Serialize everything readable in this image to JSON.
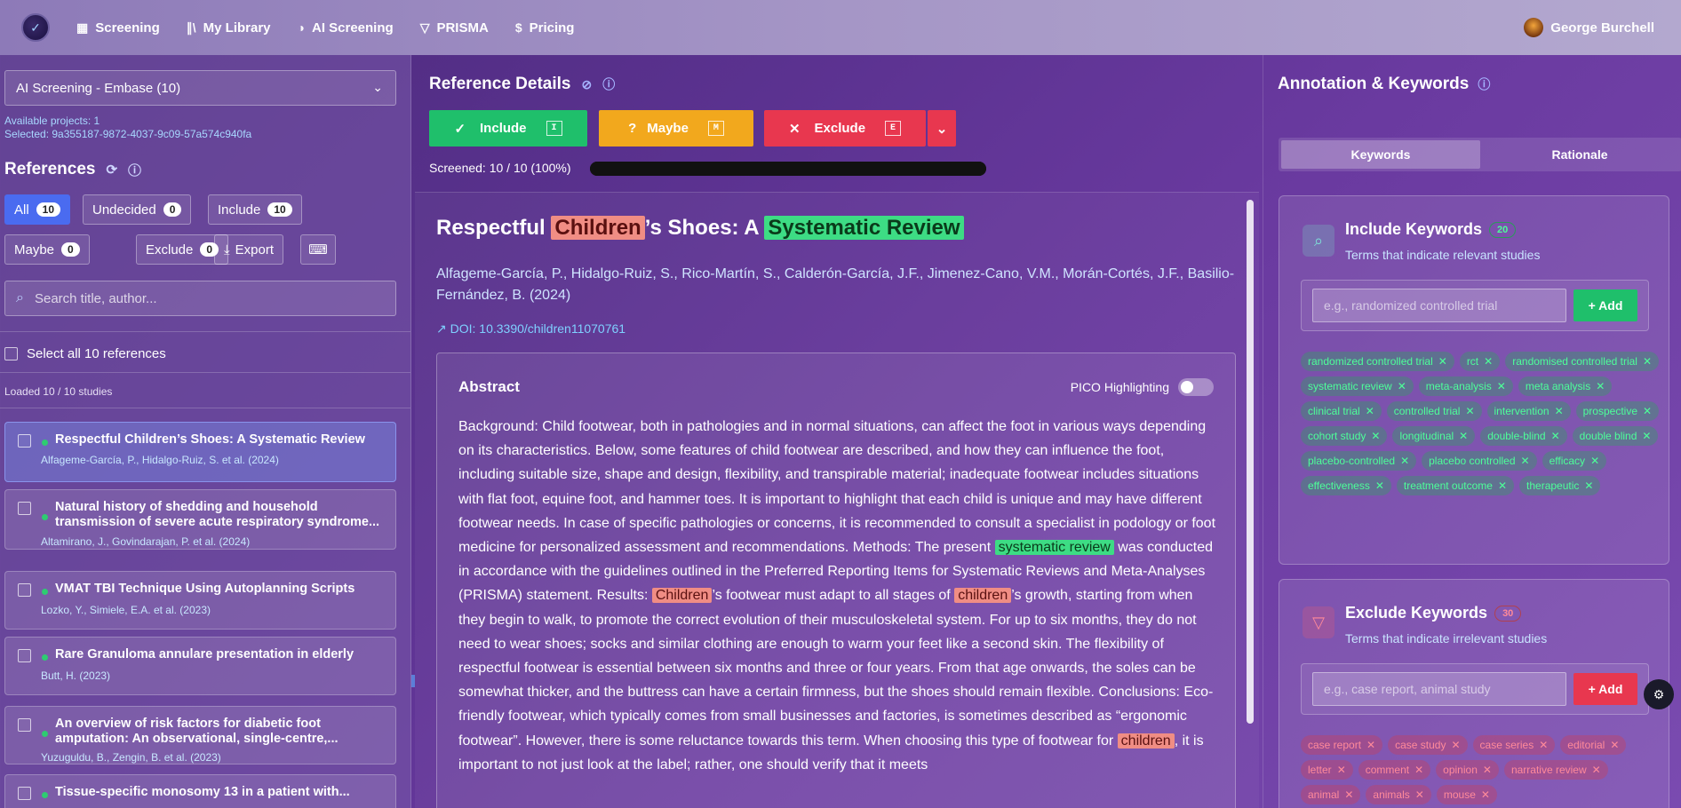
{
  "nav": {
    "items": [
      {
        "icon": "grid-icon",
        "label": "Screening"
      },
      {
        "icon": "library-icon",
        "label": "My Library"
      },
      {
        "icon": "ai-icon",
        "label": "AI Screening"
      },
      {
        "icon": "filter-icon",
        "label": "PRISMA"
      },
      {
        "icon": "dollar-icon",
        "label": "Pricing"
      }
    ],
    "user": "George Burchell"
  },
  "left": {
    "project_select": "AI Screening - Embase (10)",
    "available": "Available projects: 1",
    "selected": "Selected: 9a355187-9872-4037-9c09-57a574c940fa",
    "title": "References",
    "filters": [
      {
        "label": "All",
        "count": "10"
      },
      {
        "label": "Undecided",
        "count": "0"
      },
      {
        "label": "Include",
        "count": "10"
      },
      {
        "label": "Maybe",
        "count": "0"
      },
      {
        "label": "Exclude",
        "count": "0"
      }
    ],
    "export_label": "Export",
    "search_placeholder": "Search title, author...",
    "select_all": "Select all 10 references",
    "loaded": "Loaded 10 / 10 studies",
    "refs": [
      {
        "title": "Respectful Children’s Shoes: A Systematic Review",
        "authors": "Alfageme-García, P., Hidalgo-Ruiz, S. et al. (2024)"
      },
      {
        "title": "Natural history of shedding and household transmission of severe acute respiratory syndrome...",
        "authors": "Altamirano, J., Govindarajan, P. et al. (2024)"
      },
      {
        "title": "VMAT TBI Technique Using Autoplanning Scripts",
        "authors": "Lozko, Y., Simiele, E.A. et al. (2023)"
      },
      {
        "title": "Rare Granuloma annulare presentation in elderly",
        "authors": "Butt, H. (2023)"
      },
      {
        "title": "An overview of risk factors for diabetic foot amputation: An observational, single-centre,...",
        "authors": "Yuzuguldu, B., Zengin, B. et al. (2023)"
      },
      {
        "title": "Tissue-specific monosomy 13 in a patient with...",
        "authors": ""
      }
    ]
  },
  "mid": {
    "title": "Reference Details",
    "decisions": [
      {
        "label": "Include",
        "key": "I"
      },
      {
        "label": "Maybe",
        "key": "M"
      },
      {
        "label": "Exclude",
        "key": "E"
      }
    ],
    "screened": "Screened: 10 / 10 (100%)",
    "progress": 1.0,
    "article": {
      "title_pre": "Respectful ",
      "title_hl1": "Children",
      "title_mid": "’s Shoes: A ",
      "title_hl2": "Systematic Review",
      "authors": "Alfageme-García, P., Hidalgo-Ruiz, S., Rico-Martín, S., Calderón-García, J.F., Jimenez-Cano, V.M., Morán-Cortés, J.F., Basilio-Fernández, B. (2024)",
      "doi": "DOI: 10.3390/children11070761"
    },
    "abstract": {
      "heading": "Abstract",
      "pico_label": "PICO Highlighting",
      "p1": "Background: Child footwear, both in pathologies and in normal situations, can affect the foot in various ways depending on its characteristics. Below, some features of child footwear are described, and how they can influence the foot, including suitable size, shape and design, flexibility, and transpirable material; inadequate footwear includes situations with flat foot, equine foot, and hammer toes. It is important to highlight that each child is unique and may have different footwear needs. In case of specific pathologies or concerns, it is recommended to consult a specialist in podology or foot medicine for personalized assessment and recommendations. Methods: The present ",
      "hl1": "systematic review",
      "p2": " was conducted in accordance with the guidelines outlined in the Preferred Reporting Items for Systematic Reviews and Meta-Analyses (PRISMA) statement. Results: ",
      "hl2": "Children",
      "p3": "’s footwear must adapt to all stages of ",
      "hl3": "children",
      "p4": "’s growth, starting from when they begin to walk, to promote the correct evolution of their musculoskeletal system. For up to six months, they do not need to wear shoes; socks and similar clothing are enough to warm your feet like a second skin. The flexibility of respectful footwear is essential between six months and three or four years. From that age onwards, the soles can be somewhat thicker, and the buttress can have a certain firmness, but the shoes should remain flexible. Conclusions: Eco-friendly footwear, which typically comes from small businesses and factories, is sometimes described as “ergonomic footwear”. However, there is some reluctance towards this term. When choosing this type of footwear for ",
      "hl4": "children",
      "p5": ", it is important to not just look at the label; rather, one should verify that it meets"
    }
  },
  "right": {
    "title": "Annotation & Keywords",
    "tabs": [
      "Keywords",
      "Rationale"
    ],
    "include": {
      "title": "Include Keywords",
      "count": "20",
      "subtitle": "Terms that indicate relevant studies",
      "placeholder": "e.g., randomized controlled trial",
      "add": "+ Add",
      "chips": [
        "randomized controlled trial",
        "rct",
        "randomised controlled trial",
        "systematic review",
        "meta-analysis",
        "meta analysis",
        "clinical trial",
        "controlled trial",
        "intervention",
        "prospective",
        "cohort study",
        "longitudinal",
        "double-blind",
        "double blind",
        "placebo-controlled",
        "placebo controlled",
        "efficacy",
        "effectiveness",
        "treatment outcome",
        "therapeutic"
      ]
    },
    "exclude": {
      "title": "Exclude Keywords",
      "count": "30",
      "subtitle": "Terms that indicate irrelevant studies",
      "placeholder": "e.g., case report, animal study",
      "add": "+ Add",
      "chips": [
        "case report",
        "case study",
        "case series",
        "editorial",
        "letter",
        "comment",
        "opinion",
        "narrative review",
        "animal",
        "animals",
        "mouse"
      ]
    }
  },
  "colors": {
    "include": "#1fbf6b",
    "maybe": "#f2a81d",
    "exclude": "#e8374f"
  }
}
